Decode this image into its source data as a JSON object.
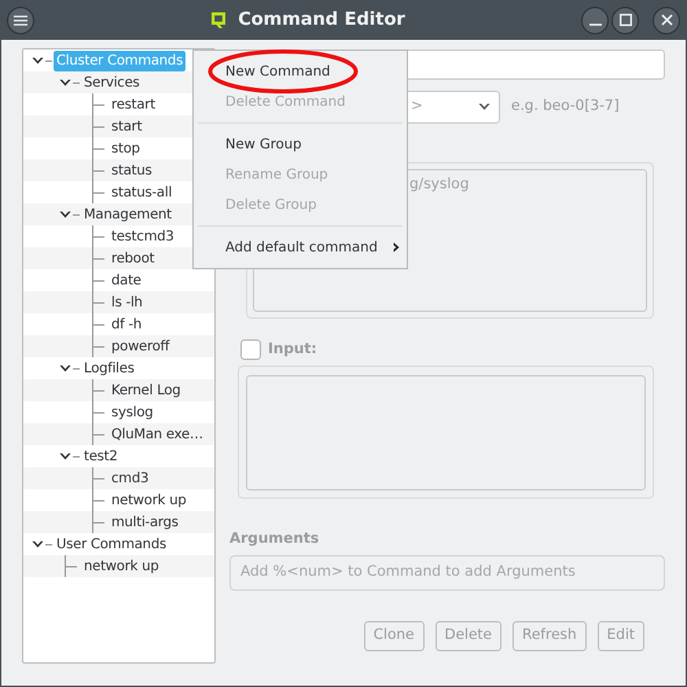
{
  "window": {
    "title": "Command Editor"
  },
  "tree": [
    {
      "label": "Cluster Commands",
      "selected": true,
      "expanded": true,
      "children": [
        {
          "label": "Services",
          "selected": false,
          "expanded": true,
          "children": [
            {
              "label": "restart",
              "selected": false
            },
            {
              "label": "start",
              "selected": false
            },
            {
              "label": "stop",
              "selected": false
            },
            {
              "label": "status",
              "selected": false
            },
            {
              "label": "status-all",
              "selected": false
            }
          ]
        },
        {
          "label": "Management",
          "selected": false,
          "expanded": true,
          "children": [
            {
              "label": "testcmd3",
              "selected": false
            },
            {
              "label": "reboot",
              "selected": false
            },
            {
              "label": "date",
              "selected": false
            },
            {
              "label": "ls -lh",
              "selected": false
            },
            {
              "label": "df -h",
              "selected": false
            },
            {
              "label": "poweroff",
              "selected": false
            }
          ]
        },
        {
          "label": "Logfiles",
          "selected": false,
          "expanded": true,
          "children": [
            {
              "label": "Kernel Log",
              "selected": false
            },
            {
              "label": "syslog",
              "selected": false
            },
            {
              "label": "QluMan exe…",
              "selected": false
            }
          ]
        },
        {
          "label": "test2",
          "selected": false,
          "expanded": true,
          "children": [
            {
              "label": "cmd3",
              "selected": false
            },
            {
              "label": "network up",
              "selected": false
            },
            {
              "label": "multi-args",
              "selected": false
            }
          ]
        }
      ]
    },
    {
      "label": "User Commands",
      "selected": false,
      "expanded": true,
      "children": [
        {
          "label": "network up",
          "selected": false
        }
      ]
    }
  ],
  "host_select": {
    "value": ">"
  },
  "host_hint": "e.g. beo-0[3-7]",
  "command_box": {
    "value": "g/syslog"
  },
  "input": {
    "label": "Input:",
    "checked": false
  },
  "arguments": {
    "label": "Arguments",
    "placeholder": "Add %<num> to Command to add Arguments"
  },
  "buttons": [
    {
      "label": "Clone",
      "disabled": true
    },
    {
      "label": "Delete",
      "disabled": true
    },
    {
      "label": "Refresh",
      "disabled": true
    },
    {
      "label": "Edit",
      "disabled": true
    }
  ],
  "context_menu": {
    "items": [
      {
        "kind": "item",
        "label": "New Command",
        "disabled": false,
        "circled": true
      },
      {
        "kind": "item",
        "label": "Delete Command",
        "disabled": true,
        "circled": false
      },
      {
        "kind": "separator"
      },
      {
        "kind": "item",
        "label": "New Group",
        "disabled": false,
        "circled": false
      },
      {
        "kind": "item",
        "label": "Rename Group",
        "disabled": true,
        "circled": false
      },
      {
        "kind": "item",
        "label": "Delete Group",
        "disabled": true,
        "circled": false
      },
      {
        "kind": "separator"
      },
      {
        "kind": "submenu",
        "label": "Add default command",
        "disabled": false,
        "circled": false
      }
    ]
  }
}
